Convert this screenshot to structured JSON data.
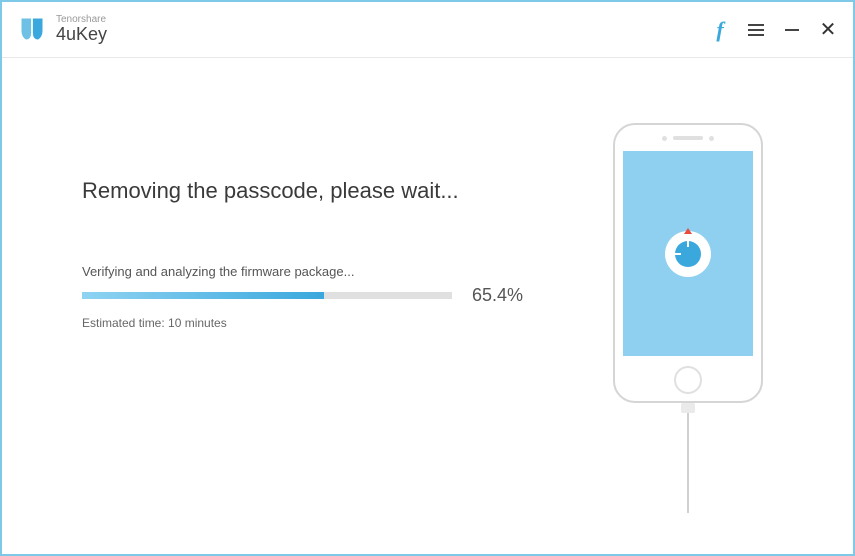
{
  "header": {
    "company": "Tenorshare",
    "appname": "4uKey"
  },
  "main": {
    "heading": "Removing the passcode, please wait...",
    "status": "Verifying and analyzing the firmware package...",
    "percent_text": "65.4%",
    "progress_percent": 65.4,
    "eta": "Estimated time: 10 minutes"
  },
  "colors": {
    "accent": "#3aa8dd",
    "border": "#7ec8e8",
    "screen": "#8fcff0"
  }
}
